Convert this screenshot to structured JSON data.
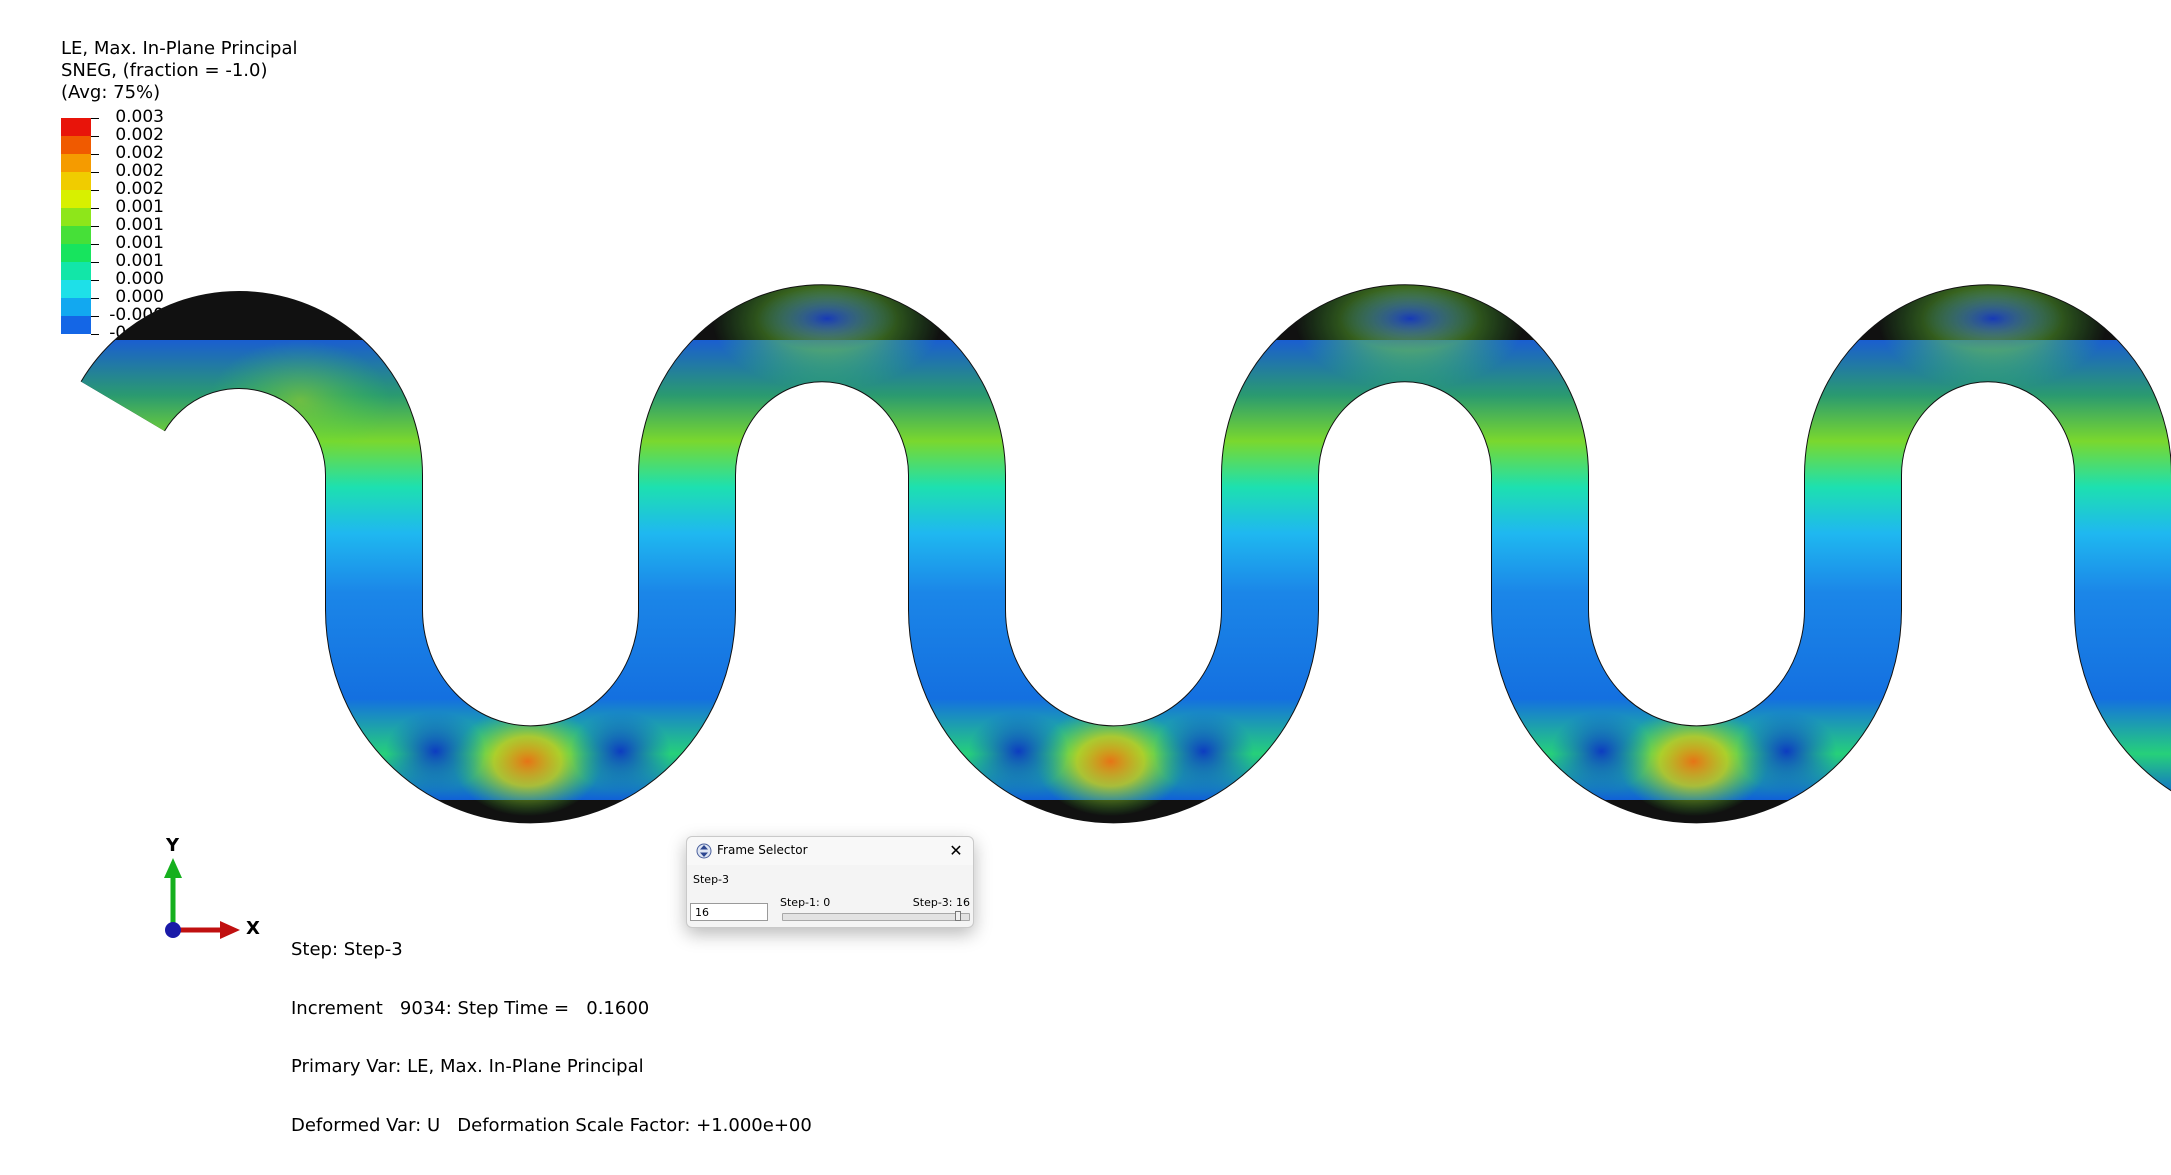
{
  "legend": {
    "title_lines": [
      "LE, Max. In-Plane Principal",
      "SNEG, (fraction = -1.0)",
      "(Avg: 75%)"
    ],
    "labels": [
      "0.003",
      "0.002",
      "0.002",
      "0.002",
      "0.002",
      "0.001",
      "0.001",
      "0.001",
      "0.001",
      "0.000",
      "0.000",
      "-0.000",
      "-0.000"
    ],
    "colors": [
      "#e8140a",
      "#f05a00",
      "#f59b00",
      "#f0cc00",
      "#d8f000",
      "#8ee61a",
      "#46e038",
      "#17e45e",
      "#12e6a8",
      "#1ee0e8",
      "#12a8f0",
      "#1466e6",
      "#1030e0"
    ]
  },
  "triad": {
    "y_label": "Y",
    "x_label": "X"
  },
  "status": {
    "lines": [
      "Step: Step-3",
      "Increment   9034: Step Time =   0.1600",
      "Primary Var: LE, Max. In-Plane Principal",
      "Deformed Var: U   Deformation Scale Factor: +1.000e+00"
    ]
  },
  "frame_selector": {
    "title": "Frame Selector",
    "step_label": "Step-3",
    "frame_value": "16",
    "min_label": "Step-1: 0",
    "max_label": "Step-3: 16",
    "slider_fraction": 1.0
  }
}
